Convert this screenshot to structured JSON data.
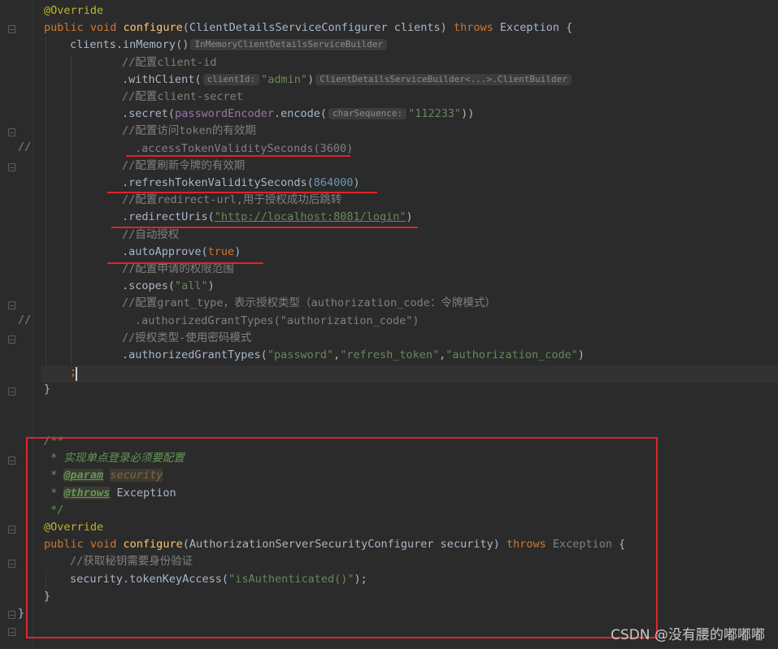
{
  "editor": {
    "lines": [
      [
        [
          "ann",
          "@Override"
        ]
      ],
      [
        [
          "kw",
          "public void "
        ],
        [
          "fn",
          "configure"
        ],
        [
          "t",
          "(ClientDetailsServiceConfigurer clients) "
        ],
        [
          "kw",
          "throws "
        ],
        [
          "t",
          "Exception {"
        ]
      ],
      [
        [
          "t",
          "clients."
        ],
        [
          "t",
          "inMemory"
        ],
        [
          "t",
          "()"
        ],
        [
          "hint",
          "InMemoryClientDetailsServiceBuilder"
        ]
      ],
      [
        [
          "cmt",
          "//配置client-id"
        ]
      ],
      [
        [
          "t",
          "."
        ],
        [
          "t",
          "withClient"
        ],
        [
          "t",
          "("
        ],
        [
          "hint",
          "clientId:"
        ],
        [
          "str",
          "\"admin\""
        ],
        [
          "t",
          ")"
        ],
        [
          "hint",
          "ClientDetailsServiceBuilder<...>.ClientBuilder"
        ]
      ],
      [
        [
          "cmt",
          "//配置client-secret"
        ]
      ],
      [
        [
          "t",
          "."
        ],
        [
          "t",
          "secret"
        ],
        [
          "t",
          "("
        ],
        [
          "field",
          "passwordEncoder"
        ],
        [
          "t",
          ".encode("
        ],
        [
          "hint",
          "charSequence:"
        ],
        [
          "str",
          "\"112233\""
        ],
        [
          "t",
          "))"
        ]
      ],
      [
        [
          "cmt",
          "//配置访问token的有效期"
        ]
      ],
      [
        [
          "cmt",
          ".accessTokenValiditySeconds(3600)"
        ]
      ],
      [
        [
          "cmt",
          "//配置刷新令牌的有效期"
        ]
      ],
      [
        [
          "t",
          ".refreshTokenValiditySeconds("
        ],
        [
          "num",
          "864000"
        ],
        [
          "t",
          ")"
        ]
      ],
      [
        [
          "cmt",
          "//配置redirect-url,用于授权成功后跳转"
        ]
      ],
      [
        [
          "t",
          ".redirectUris("
        ],
        [
          "link",
          "\"http://localhost:8081/login\""
        ],
        [
          "t",
          ")"
        ]
      ],
      [
        [
          "cmt",
          "//自动授权"
        ]
      ],
      [
        [
          "t",
          ".autoApprove("
        ],
        [
          "kw",
          "true"
        ],
        [
          "t",
          ")"
        ]
      ],
      [
        [
          "cmt",
          "//配置申请的权限范围"
        ]
      ],
      [
        [
          "t",
          ".scopes("
        ],
        [
          "str",
          "\"all\""
        ],
        [
          "t",
          ")"
        ]
      ],
      [
        [
          "cmt",
          "//配置grant_type，表示授权类型（authorization_code：令牌模式）"
        ]
      ],
      [
        [
          "cmt",
          ".authorizedGrantTypes(\"authorization_code\")"
        ]
      ],
      [
        [
          "cmt",
          "//授权类型-使用密码模式"
        ]
      ],
      [
        [
          "t",
          ".authorizedGrantTypes("
        ],
        [
          "str",
          "\"password\""
        ],
        [
          "t",
          ","
        ],
        [
          "str",
          "\"refresh_token\""
        ],
        [
          "t",
          ","
        ],
        [
          "str",
          "\"authorization_code\""
        ],
        [
          "t",
          ")"
        ]
      ],
      [
        [
          "kw",
          ";"
        ]
      ],
      [
        [
          "t",
          "}"
        ]
      ],
      [],
      [],
      [
        [
          "doc",
          "/**"
        ]
      ],
      [
        [
          "doc",
          " * 实现单点登录必须要配置"
        ]
      ],
      [
        [
          "doc",
          " * "
        ],
        [
          "doctag",
          "@param"
        ],
        [
          "doc",
          " "
        ],
        [
          "docparam",
          "security"
        ]
      ],
      [
        [
          "doc",
          " * "
        ],
        [
          "doctag",
          "@throws"
        ],
        [
          "doc",
          " "
        ],
        [
          "t",
          "Exception"
        ]
      ],
      [
        [
          "doc",
          " */"
        ]
      ],
      [
        [
          "ann",
          "@Override"
        ]
      ],
      [
        [
          "kw",
          "public void "
        ],
        [
          "fn",
          "configure"
        ],
        [
          "t",
          "(AuthorizationServerSecurityConfigurer security) "
        ],
        [
          "kw",
          "throws "
        ],
        [
          "cmt",
          "Exception"
        ],
        [
          "t",
          " {"
        ]
      ],
      [
        [
          "cmt",
          "//获取秘钥需要身份验证"
        ]
      ],
      [
        [
          "t",
          "security.tokenKeyAccess("
        ],
        [
          "str",
          "\"isAuthenticated()\""
        ],
        [
          "t",
          ");"
        ]
      ],
      [
        [
          "t",
          "}"
        ]
      ],
      [
        [
          "t",
          "}"
        ]
      ]
    ],
    "comment_markers": [
      "//",
      "//"
    ]
  },
  "watermark": "CSDN @没有腰的嘟嘟嘟"
}
